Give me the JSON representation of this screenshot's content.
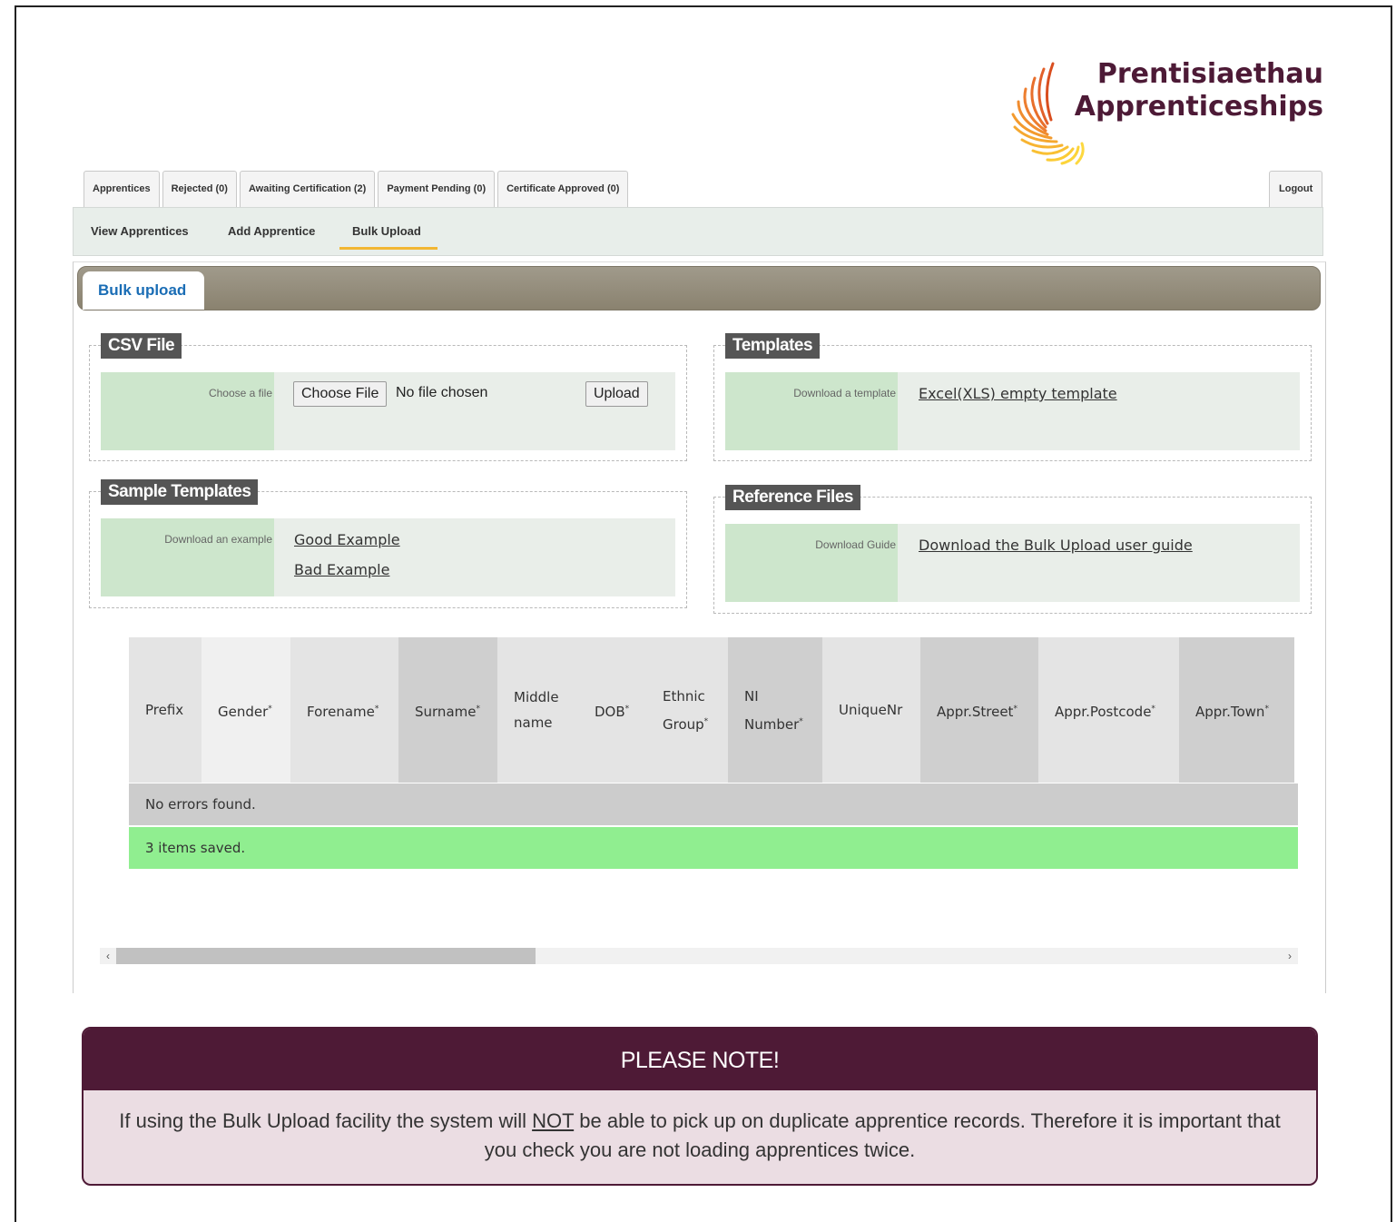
{
  "logo": {
    "line1": "Prentisiaethau",
    "line2": "Apprenticeships"
  },
  "top_tabs": [
    "Apprentices",
    "Rejected (0)",
    "Awaiting Certification (2)",
    "Payment Pending (0)",
    "Certificate Approved (0)"
  ],
  "logout_label": "Logout",
  "subnav": {
    "view": "View Apprentices",
    "add": "Add Apprentice",
    "bulk": "Bulk Upload"
  },
  "panel": {
    "tab_label": "Bulk upload"
  },
  "csv": {
    "legend": "CSV File",
    "label": "Choose a file",
    "choose_btn": "Choose File",
    "no_file": "No file chosen",
    "upload_btn": "Upload"
  },
  "templates": {
    "legend": "Templates",
    "label": "Download a template",
    "link": "Excel(XLS) empty template"
  },
  "samples": {
    "legend": "Sample Templates",
    "label": "Download an example",
    "good": "Good Example",
    "bad": "Bad Example"
  },
  "reference": {
    "legend": "Reference Files",
    "label": "Download Guide",
    "link": "Download the Bulk Upload user guide"
  },
  "table": {
    "columns": [
      {
        "line1": "Prefix",
        "line2": "",
        "req": ""
      },
      {
        "line1": "Gender",
        "line2": "",
        "req": "*"
      },
      {
        "line1": "Forename",
        "line2": "",
        "req": "*"
      },
      {
        "line1": "Surname",
        "line2": "",
        "req": "*"
      },
      {
        "line1": "Middle",
        "line2": "name",
        "req": ""
      },
      {
        "line1": "DOB",
        "line2": "",
        "req": "*"
      },
      {
        "line1": "Ethnic",
        "line2": "Group",
        "req": "*"
      },
      {
        "line1": "NI",
        "line2": "Number",
        "req": "*"
      },
      {
        "line1": "UniqueNr",
        "line2": "",
        "req": ""
      },
      {
        "line1": "Appr.Street",
        "line2": "",
        "req": "*"
      },
      {
        "line1": "Appr.Postcode",
        "line2": "",
        "req": "*"
      },
      {
        "line1": "Appr.Town",
        "line2": "",
        "req": "*"
      }
    ],
    "errors_msg": "No errors found.",
    "saved_msg": "3 items saved."
  },
  "note": {
    "title": "PLEASE NOTE!",
    "text_before": "If using the Bulk Upload facility the system will ",
    "emphasis": "NOT",
    "text_after": " be able to pick up on duplicate apprentice records. Therefore it is important that you check you are not loading apprentices twice."
  },
  "colors": {
    "brand": "#4e1a36",
    "label_bg": "#cde6cc",
    "saved_bg": "#90ee90",
    "errors_bg": "#cccccc",
    "accent": "#f2b632"
  }
}
